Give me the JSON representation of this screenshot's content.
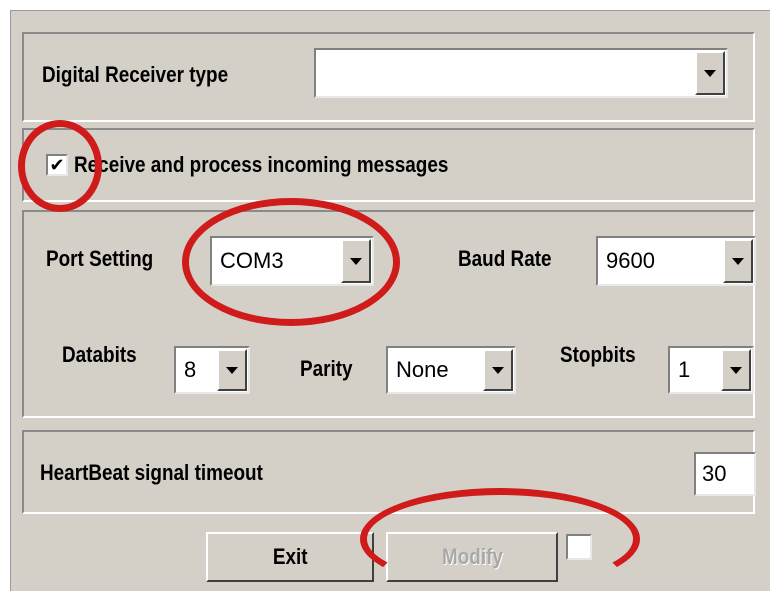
{
  "receiver": {
    "label": "Digital Receiver type",
    "value": ""
  },
  "receive": {
    "label": "Receive and process incoming messages",
    "checked": true,
    "check_glyph": "✔"
  },
  "port": {
    "port_label": "Port Setting",
    "port_value": "COM3",
    "baud_label": "Baud Rate",
    "baud_value": "9600",
    "databits_label": "Databits",
    "databits_value": "8",
    "parity_label": "Parity",
    "parity_value": "None",
    "stopbits_label": "Stopbits",
    "stopbits_value": "1"
  },
  "heartbeat": {
    "label": "HeartBeat signal timeout",
    "value": "30"
  },
  "buttons": {
    "exit": "Exit",
    "modify": "Modify"
  },
  "annotation_color": "#d01b1b"
}
